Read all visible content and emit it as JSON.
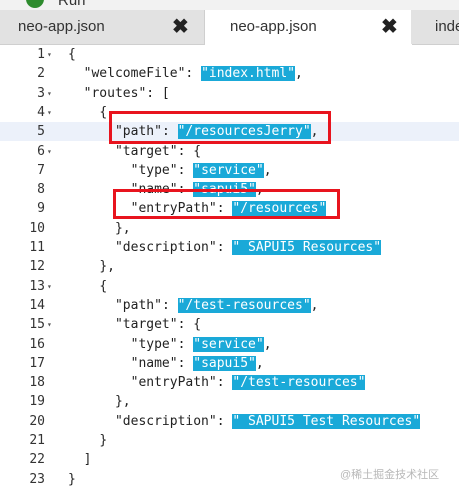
{
  "toolbar": {
    "run_label": "Run"
  },
  "tabs": [
    {
      "label": "neo-app.json",
      "active": false
    },
    {
      "label": "neo-app.json",
      "active": true
    },
    {
      "label": "index"
    }
  ],
  "editor": {
    "lines": [
      {
        "n": "1",
        "fold": "▾"
      },
      {
        "n": "2"
      },
      {
        "n": "3",
        "fold": "▾"
      },
      {
        "n": "4",
        "fold": "▾"
      },
      {
        "n": "5"
      },
      {
        "n": "6",
        "fold": "▾"
      },
      {
        "n": "7"
      },
      {
        "n": "8"
      },
      {
        "n": "9"
      },
      {
        "n": "10"
      },
      {
        "n": "11"
      },
      {
        "n": "12"
      },
      {
        "n": "13",
        "fold": "▾"
      },
      {
        "n": "14"
      },
      {
        "n": "15",
        "fold": "▾"
      },
      {
        "n": "16"
      },
      {
        "n": "17"
      },
      {
        "n": "18"
      },
      {
        "n": "19"
      },
      {
        "n": "20"
      },
      {
        "n": "21"
      },
      {
        "n": "22"
      },
      {
        "n": "23"
      }
    ],
    "text": {
      "l1": "{",
      "l2_key": "\"welcomeFile\"",
      "l2_val": "\"index.html\"",
      "l3_key": "\"routes\"",
      "l3_rest": ": [",
      "l4": "{",
      "l5_key": "\"path\"",
      "l5_val": "\"/resourcesJerry\"",
      "l6_key": "\"target\"",
      "l6_rest": ": {",
      "l7_key": "\"type\"",
      "l7_val": "\"service\"",
      "l8_key": "\"name\"",
      "l8_val": "\"sapui5\"",
      "l9_key": "\"entryPath\"",
      "l9_val": "\"/resources\"",
      "l10": "},",
      "l11_key": "\"description\"",
      "l11_val": "\" SAPUI5 Resources\"",
      "l12": "},",
      "l13": "{",
      "l14_key": "\"path\"",
      "l14_val": "\"/test-resources\"",
      "l15_key": "\"target\"",
      "l15_rest": ": {",
      "l16_key": "\"type\"",
      "l16_val": "\"service\"",
      "l17_key": "\"name\"",
      "l17_val": "\"sapui5\"",
      "l18_key": "\"entryPath\"",
      "l18_val": "\"/test-resources\"",
      "l19": "},",
      "l20_key": "\"description\"",
      "l20_val": "\" SAPUI5 Test Resources\"",
      "l21": "}",
      "l22": "]",
      "l23": "}"
    }
  },
  "watermark": "@稀土掘金技术社区",
  "colors": {
    "string_highlight": "#1aa9d8",
    "annotation_box": "#e8141e",
    "active_line": "#ecf1fa"
  },
  "icons": {
    "run": "run-icon",
    "tab_close": "close-icon",
    "fold": "fold-arrow-icon"
  }
}
